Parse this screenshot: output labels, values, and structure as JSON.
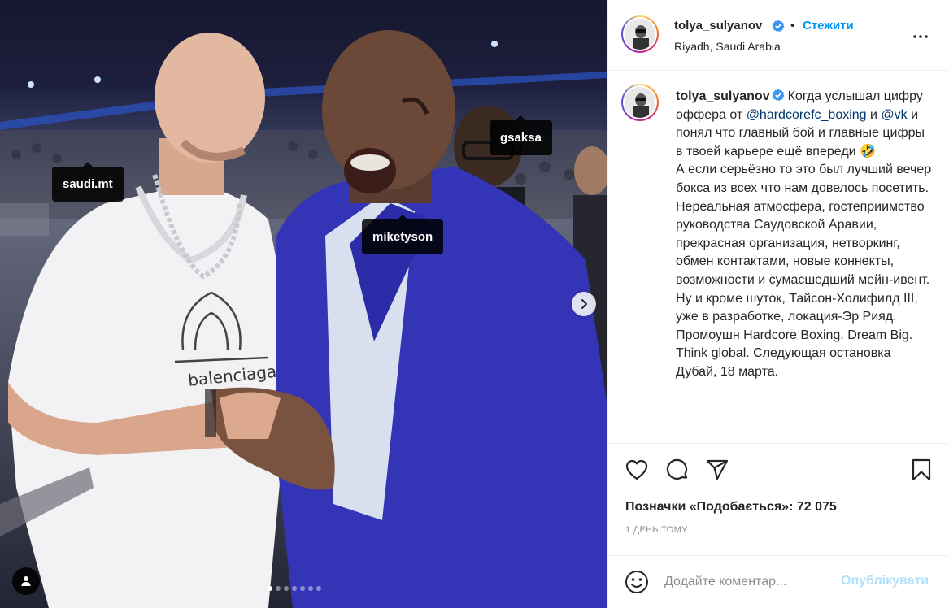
{
  "post": {
    "username": "tolya_sulyanov",
    "follow_label": "Стежити",
    "separator": "•",
    "location": "Riyadh, Saudi Arabia",
    "more_icon": "more-horizontal-icon",
    "verified_icon": "verified-badge-icon"
  },
  "photo": {
    "tags": {
      "saudi": "saudi.mt",
      "mike": "miketyson",
      "gsak": "gsaksa"
    },
    "carousel": {
      "count": 7,
      "active_index": 0
    },
    "shirt_text": "balenciaga"
  },
  "caption": {
    "username": "tolya_sulyanov",
    "part1": "Когда услышал цифру оффера от ",
    "mention1": "@hardcorefc_boxing",
    "part2": " и ",
    "mention2": "@vk",
    "part3": " и понял что главный бой и главные цифры в твоей карьере ещё впереди 🤣",
    "part4": "А если серьёзно то это был лучший вечер бокса из всех что нам довелось посетить. Нереальная атмосфера, гостеприимство руководства Саудовской Аравии, прекрасная организация, нетворкинг, обмен контактами, новые коннекты, возможности и сумасшедший мейн-ивент. Ну и кроме шуток, Тайсон-Холифилд III, уже в разработке, локация-Эр Рияд. Промоушн Hardcore Boxing. Dream Big. Think global. Следующая остановка Дубай, 18 марта."
  },
  "actions": {
    "like_icon": "heart-icon",
    "comment_icon": "comment-bubble-icon",
    "share_icon": "paper-plane-icon",
    "save_icon": "bookmark-icon"
  },
  "likes_text": "Позначки «Подобається»: 72 075",
  "time_ago": "1 ДЕНЬ ТОМУ",
  "comment": {
    "placeholder": "Додайте коментар...",
    "post_label": "Опублікувати",
    "emoji_icon": "emoji-smile-icon"
  },
  "colors": {
    "accent": "#0095f6",
    "post_disabled": "#b2dffc",
    "mention": "#00376b",
    "muted": "#8e8e8e",
    "verified": "#3897f0"
  }
}
